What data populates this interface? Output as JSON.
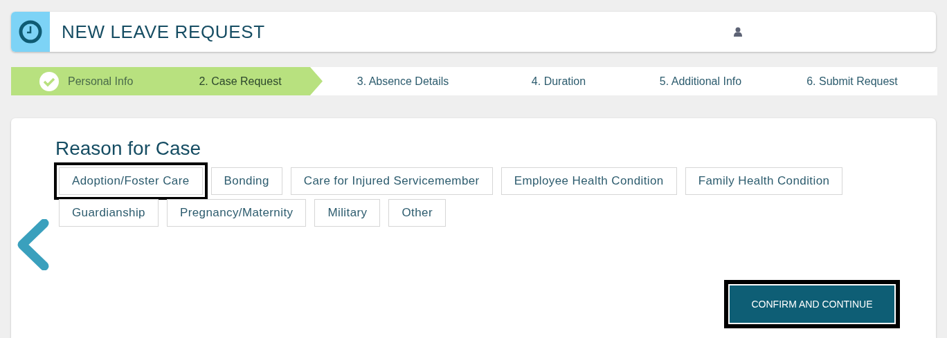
{
  "header": {
    "title": "NEW LEAVE REQUEST"
  },
  "steps": [
    {
      "label": "Personal Info",
      "completed": true,
      "selected": false
    },
    {
      "label": "2. Case Request",
      "completed": false,
      "selected": true
    },
    {
      "label": "3. Absence Details",
      "completed": false,
      "selected": false
    },
    {
      "label": "4. Duration",
      "completed": false,
      "selected": false
    },
    {
      "label": "5. Additional Info",
      "completed": false,
      "selected": false
    },
    {
      "label": "6. Submit Request",
      "completed": false,
      "selected": false
    }
  ],
  "section": {
    "title": "Reason for Case",
    "options": [
      {
        "label": "Adoption/Foster Care",
        "highlighted": true
      },
      {
        "label": "Bonding",
        "highlighted": false
      },
      {
        "label": "Care for Injured Servicemember",
        "highlighted": false
      },
      {
        "label": "Employee Health Condition",
        "highlighted": false
      },
      {
        "label": "Family Health Condition",
        "highlighted": false
      },
      {
        "label": "Guardianship",
        "highlighted": false
      },
      {
        "label": "Pregnancy/Maternity",
        "highlighted": false
      },
      {
        "label": "Military",
        "highlighted": false
      },
      {
        "label": "Other",
        "highlighted": false
      }
    ]
  },
  "confirm_button": {
    "label": "CONFIRM AND CONTINUE",
    "highlighted": true
  }
}
